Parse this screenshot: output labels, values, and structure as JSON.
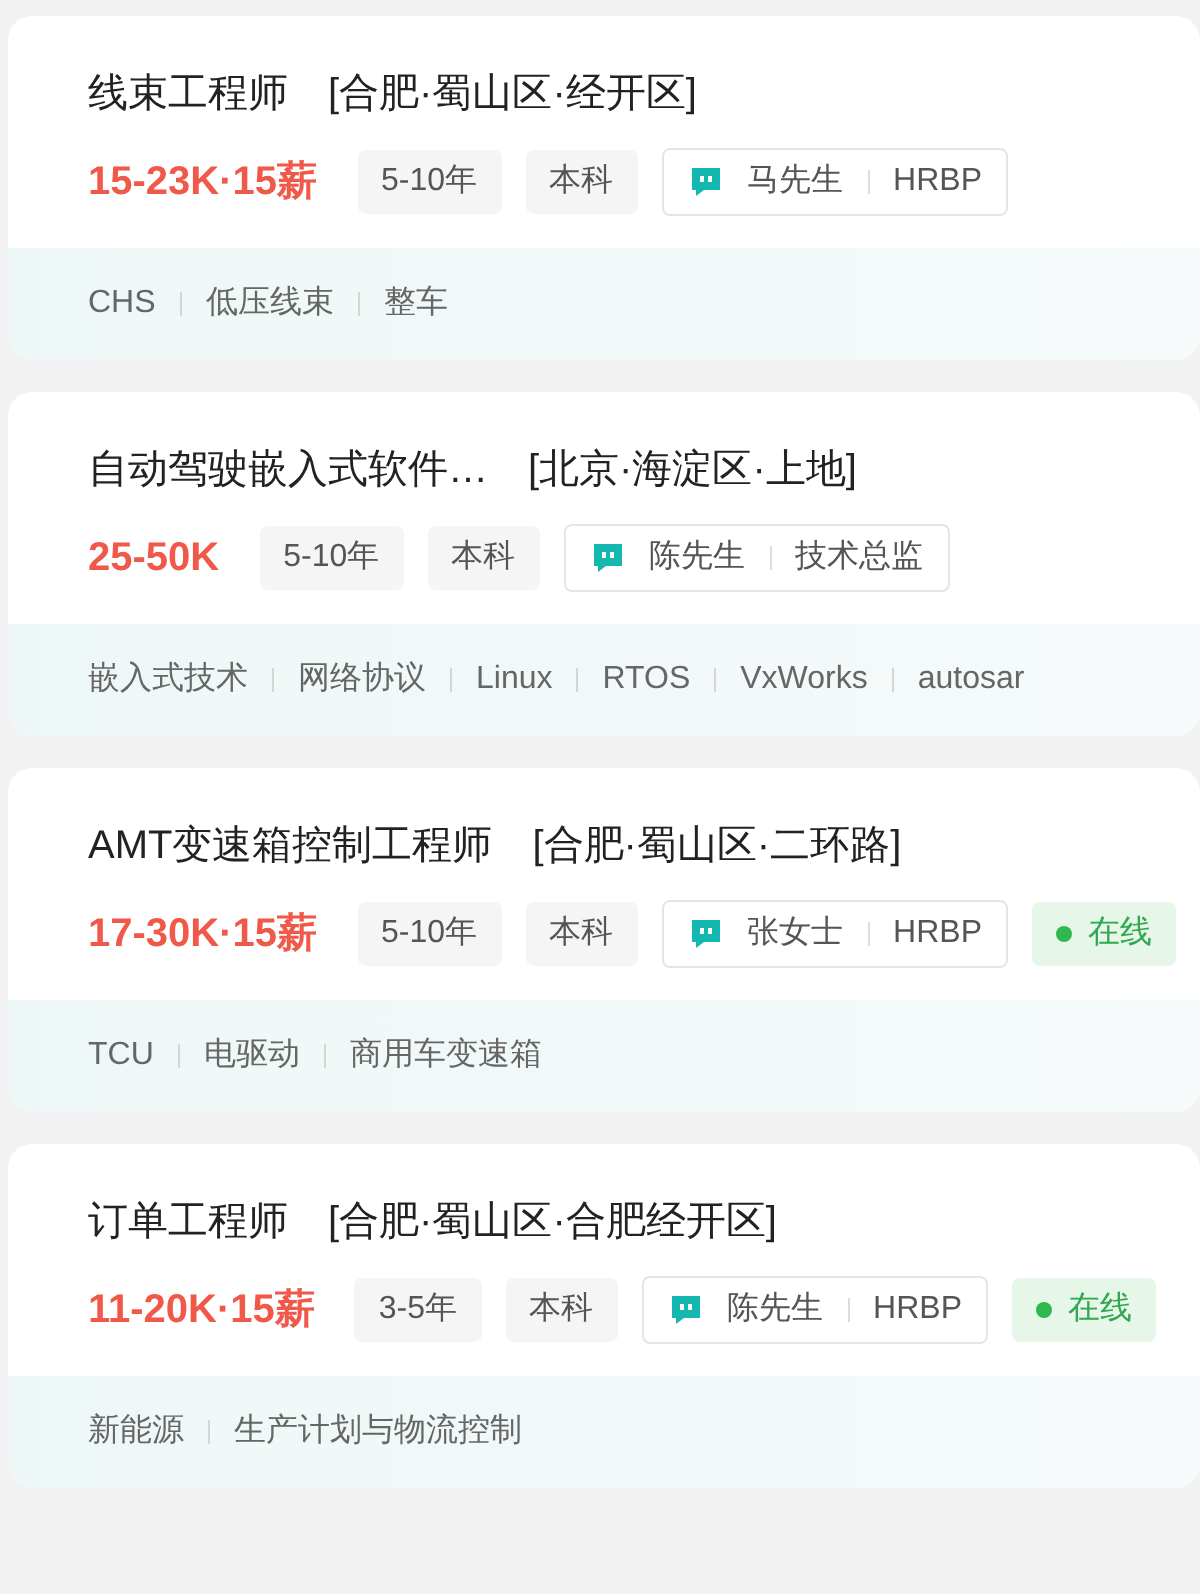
{
  "jobs": [
    {
      "title": "线束工程师",
      "location": "[合肥·蜀山区·经开区]",
      "salary": "15-23K·15薪",
      "experience": "5-10年",
      "degree": "本科",
      "recruiter": "马先生",
      "recruiter_role": "HRBP",
      "online": false,
      "skills": [
        "CHS",
        "低压线束",
        "整车"
      ]
    },
    {
      "title": "自动驾驶嵌入式软件…",
      "location": "[北京·海淀区·上地]",
      "salary": "25-50K",
      "experience": "5-10年",
      "degree": "本科",
      "recruiter": "陈先生",
      "recruiter_role": "技术总监",
      "online": false,
      "skills": [
        "嵌入式技术",
        "网络协议",
        "Linux",
        "RTOS",
        "VxWorks",
        "autosar"
      ]
    },
    {
      "title": "AMT变速箱控制工程师",
      "location": "[合肥·蜀山区·二环路]",
      "salary": "17-30K·15薪",
      "experience": "5-10年",
      "degree": "本科",
      "recruiter": "张女士",
      "recruiter_role": "HRBP",
      "online": true,
      "online_label": "在线",
      "skills": [
        "TCU",
        "电驱动",
        "商用车变速箱"
      ]
    },
    {
      "title": "订单工程师",
      "location": "[合肥·蜀山区·合肥经开区]",
      "salary": "11-20K·15薪",
      "experience": "3-5年",
      "degree": "本科",
      "recruiter": "陈先生",
      "recruiter_role": "HRBP",
      "online": true,
      "online_label": "在线",
      "skills": [
        "新能源",
        "生产计划与物流控制"
      ]
    }
  ]
}
